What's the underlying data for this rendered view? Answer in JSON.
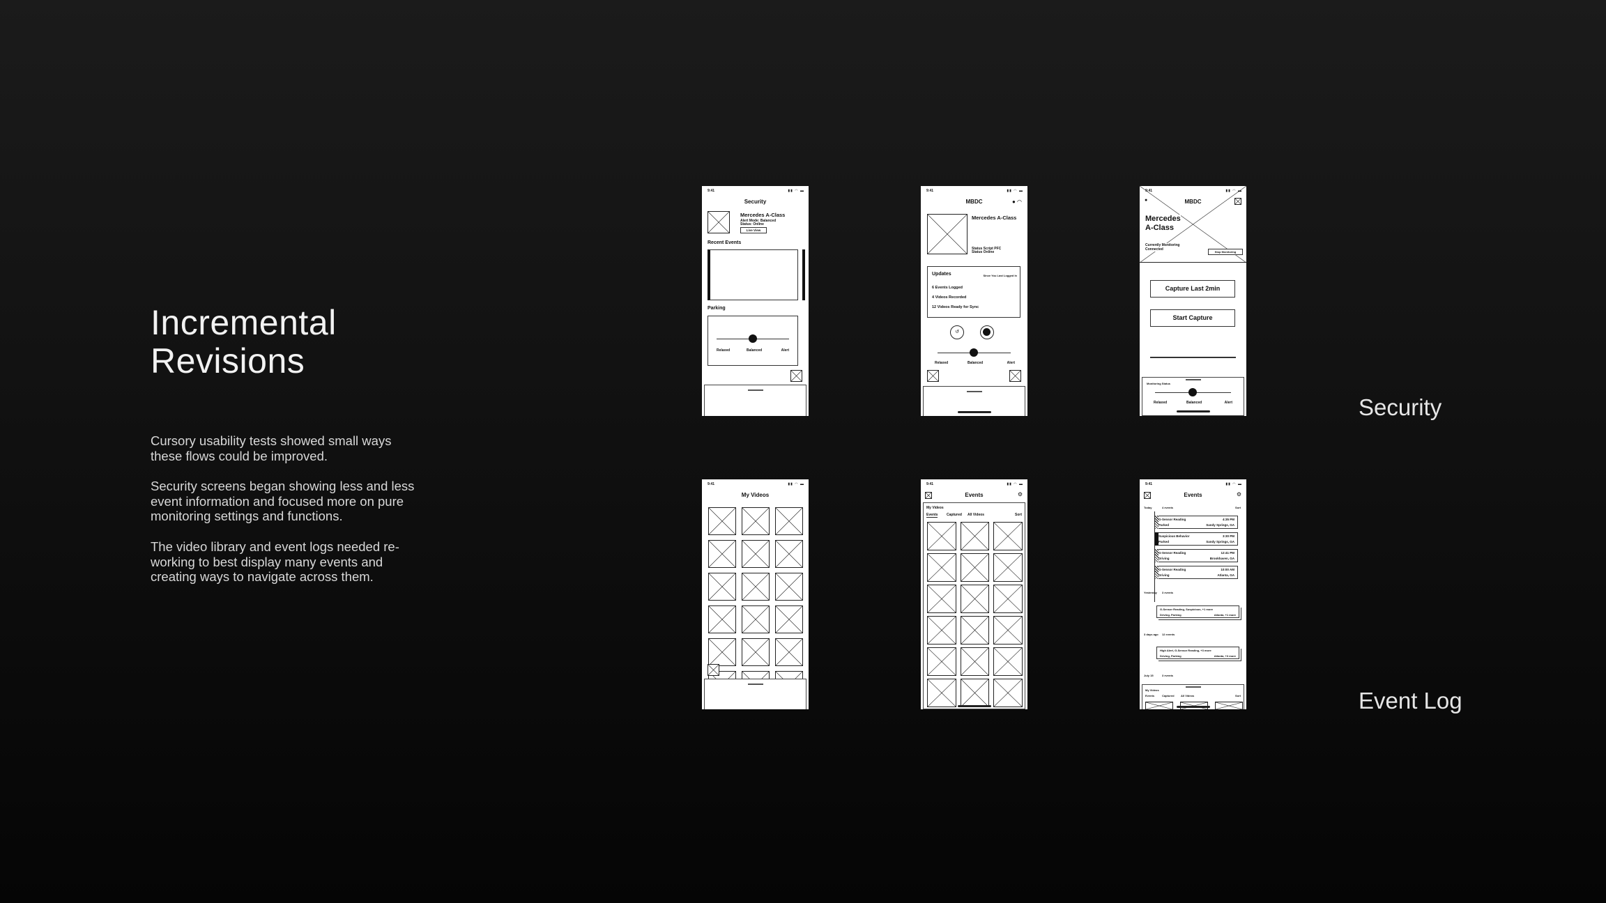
{
  "slide": {
    "title_line1": "Incremental",
    "title_line2": "Revisions",
    "paragraphs": [
      "Cursory usability tests showed small ways these flows could be improved.",
      "Security screens began showing less and less event information and focused more on pure monitoring settings and functions.",
      "The video library and event logs needed re-working to best display many events and creating ways to navigate across them."
    ],
    "section_labels": [
      "Security",
      "Event Log"
    ]
  },
  "wireframes": {
    "status_time": "9:41",
    "security_v1": {
      "title": "Security",
      "car_name": "Mercedes A-Class",
      "car_status": "Alert Mode: Balanced",
      "car_status2": "Status: Online",
      "live_view": "Live View",
      "recent_events": "Recent Events",
      "parking": "Parking",
      "slider_labels": [
        "Relaxed",
        "Balanced",
        "Alert"
      ]
    },
    "security_v2": {
      "title": "MBDC",
      "car_name": "Mercedes A-Class",
      "status_line1": "Status Script PFC",
      "status_line2": "Status Online",
      "updates_title": "Updates",
      "updates_since": "Since You Last Logged In",
      "updates": [
        "6 Events Logged",
        "4 Videos Recorded",
        "12 Videos Ready for Sync"
      ],
      "slider_labels": [
        "Relaxed",
        "Balanced",
        "Alert"
      ]
    },
    "security_v3": {
      "title": "MBDC",
      "car_name_line1": "Mercedes",
      "car_name_line2": "A-Class",
      "monitor_line1": "Currently Monitoring",
      "monitor_line2": "Connected",
      "stop_button": "Stop Monitoring",
      "capture_last": "Capture Last 2min",
      "start_capture": "Start Capture",
      "monitoring_status": "Monitoring Status",
      "slider_labels": [
        "Relaxed",
        "Balanced",
        "Alert"
      ]
    },
    "videos": {
      "title": "My Videos"
    },
    "events_v1": {
      "title": "Events",
      "section": "My Videos",
      "tabs": [
        "Events",
        "Captured",
        "All Videos"
      ],
      "sort": "Sort"
    },
    "events_v2": {
      "title": "Events",
      "sort": "Sort",
      "groups": [
        {
          "day": "Today",
          "count": "4 events"
        },
        {
          "day": "Yesterday",
          "count": "3 events"
        },
        {
          "day": "3 days ago",
          "count": "12 events"
        },
        {
          "day": "July 15",
          "count": "3 events"
        }
      ],
      "rows": [
        {
          "type": "G-Sensor Reading",
          "time": "4:35 PM",
          "mode": "Parked",
          "place": "Sandy Springs, GA"
        },
        {
          "type": "Suspicious Behavior",
          "time": "3:30 PM",
          "mode": "Parked",
          "place": "Sandy Springs, GA"
        },
        {
          "type": "G-Sensor Reading",
          "time": "12:41 PM",
          "mode": "Driving",
          "place": "Brookhaven, GA"
        },
        {
          "type": "G-Sensor Reading",
          "time": "10:00 AM",
          "mode": "Driving",
          "place": "Atlanta, GA"
        }
      ],
      "stack1_line1": "G-Sensor Reading, Suspicious, +1 more",
      "stack1_line2": "Driving, Parking",
      "stack1_place": "Atlanta, +1 more",
      "stack2_line1": "High Alert, G-Sensor Reading, +3 more",
      "stack2_line2": "Driving, Parking",
      "stack2_place": "Atlanta, +3 more",
      "sheet_section": "My Videos",
      "sheet_tabs": [
        "Events",
        "Captured",
        "All Videos"
      ],
      "sheet_sort": "Sort"
    }
  }
}
